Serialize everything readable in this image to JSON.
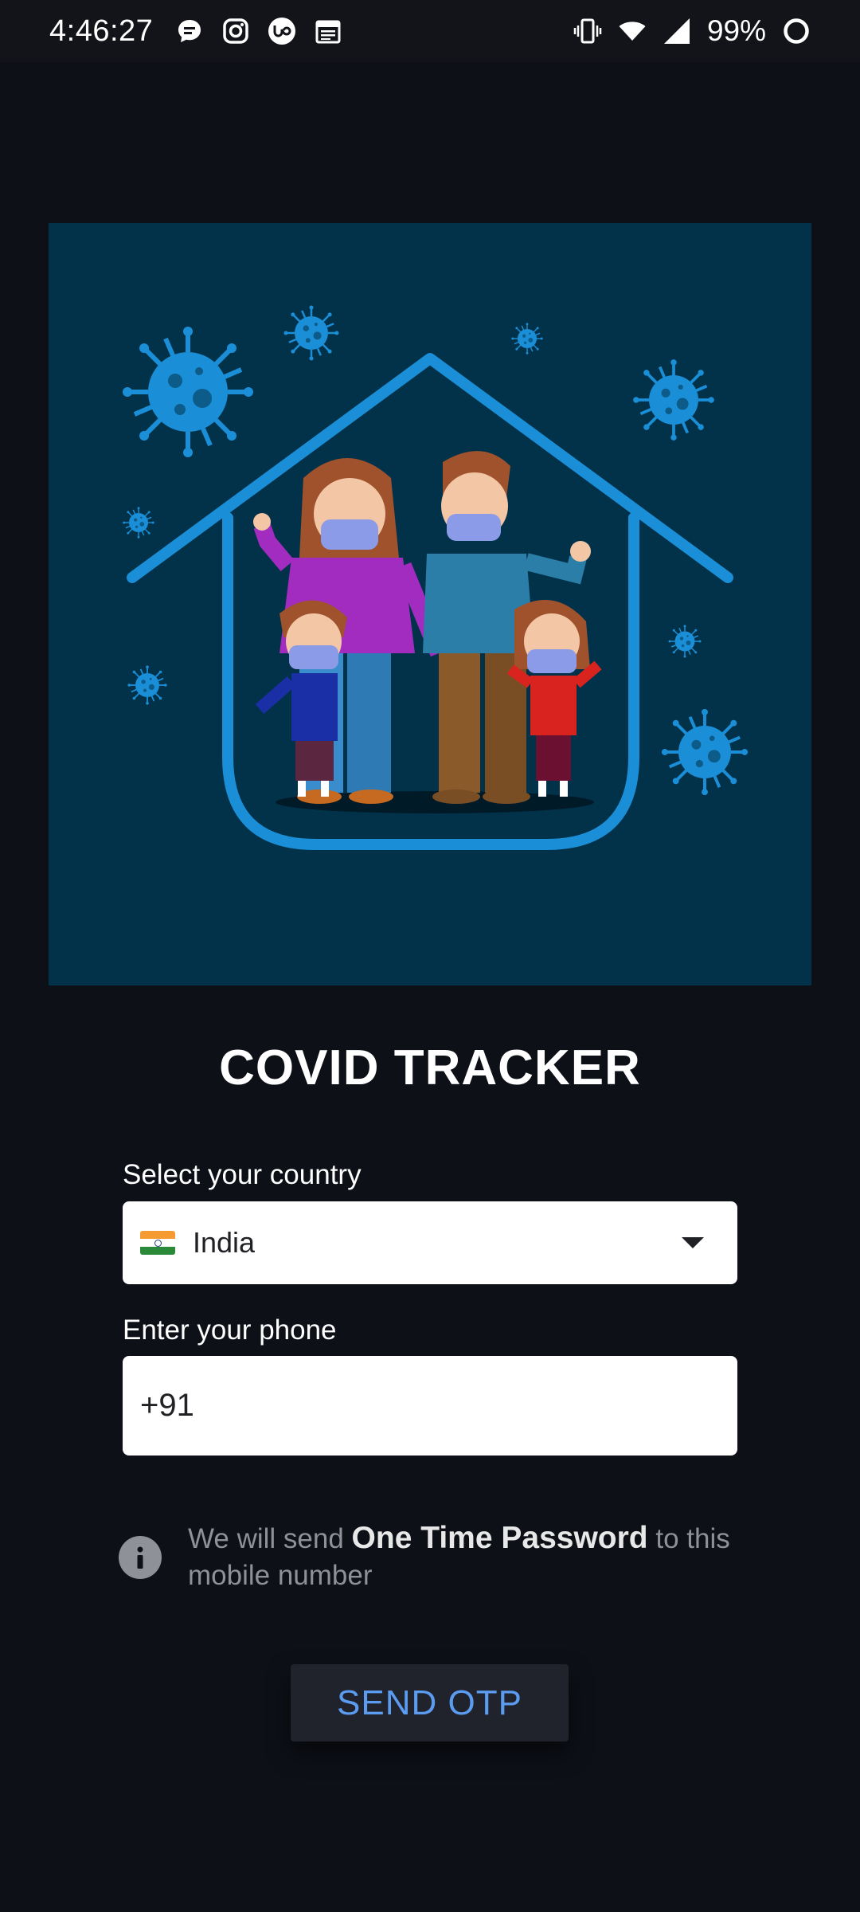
{
  "status_bar": {
    "time": "4:46:27",
    "battery_percent": "99%",
    "icons": [
      "messages-icon",
      "instagram-icon",
      "upwork-icon",
      "calendar-icon",
      "vibrate-icon",
      "wifi-icon",
      "signal-icon",
      "battery-icon"
    ]
  },
  "hero": {
    "illustration": "family-in-house-with-masks-and-virus"
  },
  "app": {
    "title": "COVID TRACKER"
  },
  "form": {
    "country_label": "Select your country",
    "country_value": "India",
    "country_flag": "india-flag-icon",
    "phone_label": "Enter your phone",
    "phone_value": "+91"
  },
  "info": {
    "prefix": "We will send ",
    "emphasis": "One Time Password",
    "suffix": " to this mobile number"
  },
  "actions": {
    "send_otp_label": "SEND OTP"
  },
  "colors": {
    "background": "#0d1017",
    "hero_background": "#02324a",
    "accent_blue": "#5b9bf0",
    "virus_blue": "#1a8fd8",
    "muted_text": "#8e9197"
  }
}
